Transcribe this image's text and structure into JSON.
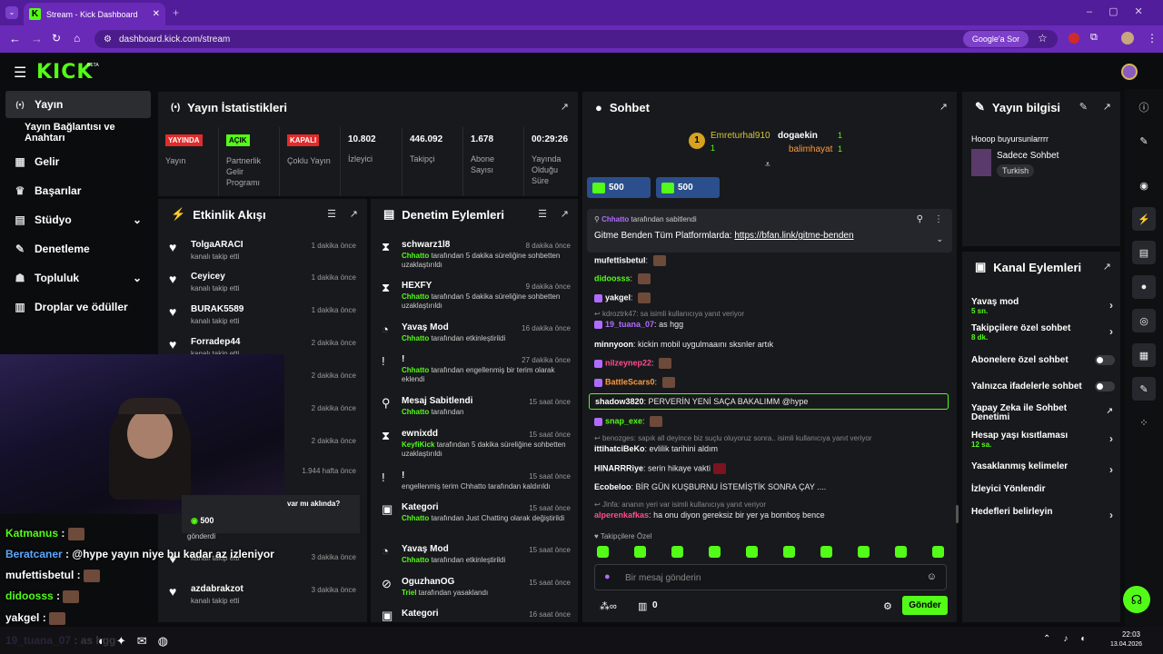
{
  "browser": {
    "tab_title": "Stream - Kick Dashboard",
    "url": "dashboard.kick.com/stream",
    "google_btn": "Google'a Sor"
  },
  "brand": {
    "logo": "KICK",
    "beta": "BETA",
    "accent": "#53fc18"
  },
  "sidebar": [
    {
      "label": "Yayın",
      "icon": "broadcast-icon",
      "active": true
    },
    {
      "label": "Yayın Bağlantısı ve Anahtarı",
      "icon": ""
    },
    {
      "label": "Gelir",
      "icon": "revenue-icon"
    },
    {
      "label": "Başarılar",
      "icon": "trophy-icon"
    },
    {
      "label": "Stüdyo",
      "icon": "studio-icon",
      "chev": "⌄"
    },
    {
      "label": "Denetleme",
      "icon": "wrench-icon"
    },
    {
      "label": "Topluluk",
      "icon": "community-icon",
      "chev": "⌄"
    },
    {
      "label": "Droplar ve ödüller",
      "icon": "gift-icon"
    }
  ],
  "stats": {
    "title": "Yayın İstatistikleri",
    "items": [
      {
        "badge": "YAYINDA",
        "label": "Yayın"
      },
      {
        "badge": "AÇIK",
        "label": "Partnerlik Gelir Programı"
      },
      {
        "badge": "KAPALI",
        "label": "Çoklu Yayın"
      },
      {
        "value": "10.802",
        "label": "İzleyici"
      },
      {
        "value": "446.092",
        "label": "Takipçi"
      },
      {
        "value": "1.678",
        "label": "Abone Sayısı"
      },
      {
        "value": "00:29:26",
        "label": "Yayında Olduğu Süre"
      }
    ]
  },
  "activity": {
    "title": "Etkinlik Akışı",
    "items": [
      {
        "name": "TolgaARACI",
        "sub": "kanalı takip etti",
        "time": "1 dakika önce"
      },
      {
        "name": "Ceyicey",
        "sub": "kanalı takip etti",
        "time": "1 dakika önce"
      },
      {
        "name": "BURAK5589",
        "sub": "kanalı takip etti",
        "time": "1 dakika önce"
      },
      {
        "name": "Forradep44",
        "sub": "kanalı takip etti",
        "time": "2 dakika önce"
      },
      {
        "name": "",
        "sub": "",
        "time": "2 dakika önce"
      },
      {
        "name": "",
        "sub": "",
        "time": "2 dakika önce"
      },
      {
        "name": "",
        "sub": "",
        "time": "2 dakika önce"
      },
      {
        "name": "",
        "sub": "",
        "time": "1.944 hafta önce"
      }
    ],
    "card_text": "var mı aklında?",
    "card_amount": "500",
    "card_sub": "gönderdi",
    "more": [
      {
        "name": "",
        "sub": "kanalı takip etti",
        "time": "3 dakika önce"
      },
      {
        "name": "azdabrakzot",
        "sub": "kanalı takip etti",
        "time": "3 dakika önce"
      }
    ]
  },
  "moderation": {
    "title": "Denetim Eylemleri",
    "items": [
      {
        "icon": "⧗",
        "name": "schwarz1l8",
        "pre": "Chhatto",
        "sub": " tarafından 5 dakika süreliğine sohbetten uzaklaştırıldı",
        "time": "8 dakika önce"
      },
      {
        "icon": "⧗",
        "name": "HEXFY",
        "pre": "Chhatto",
        "sub": " tarafından 5 dakika süreliğine sohbetten uzaklaştırıldı",
        "time": "9 dakika önce"
      },
      {
        "icon": "◔",
        "name": "Yavaş Mod",
        "pre": "Chhatto",
        "sub": " tarafından etkinleştirildi",
        "time": "16 dakika önce"
      },
      {
        "icon": "!",
        "name": "!",
        "pre": "Chhatto",
        "sub": " tarafından engellenmiş bir terim olarak eklendi",
        "time": "27 dakika önce"
      },
      {
        "icon": "⚲",
        "name": "Mesaj Sabitlendi",
        "pre": "Chhatto",
        "sub": " tarafından",
        "time": "15 saat önce"
      },
      {
        "icon": "⧗",
        "name": "ewnixdd",
        "pre": "KeyfiKick",
        "sub": " tarafından 5 dakika süreliğine sohbetten uzaklaştırıldı",
        "time": "15 saat önce"
      },
      {
        "icon": "!",
        "name": "!",
        "pre": "",
        "sub": "engellenmiş terim Chhatto tarafından kaldırıldı",
        "time": "15 saat önce"
      },
      {
        "icon": "▣",
        "name": "Kategori",
        "pre": "Chhatto",
        "sub": " tarafından Just Chatting olarak değiştirildi",
        "time": "15 saat önce"
      },
      {
        "icon": "◔",
        "name": "Yavaş Mod",
        "pre": "Chhatto",
        "sub": " tarafından etkinleştirildi",
        "time": "15 saat önce"
      },
      {
        "icon": "⊘",
        "name": "OguzhanOG",
        "pre": "Triel",
        "sub": " tarafından yasaklandı",
        "time": "15 saat önce"
      },
      {
        "icon": "▣",
        "name": "Kategori",
        "pre": "",
        "sub": "",
        "time": "16 saat önce"
      }
    ]
  },
  "chat": {
    "title": "Sohbet",
    "top": [
      {
        "rank": "1",
        "name": "Emreturhal910",
        "count": "1"
      },
      {
        "name": "dogaekin",
        "count": "1"
      },
      {
        "name": "balimhayat",
        "count": "1"
      }
    ],
    "gifts": [
      {
        "amount": "500"
      },
      {
        "amount": "500"
      }
    ],
    "pinned": {
      "by": "Chhatto",
      "by_suffix": "tarafından sabitlendi",
      "text": "Gitme Benden Tüm Platformlarda: ",
      "link": "https://bfan.link/gitme-benden"
    },
    "messages": [
      {
        "user": "mufettisbetul",
        "color": "#ffffff",
        "text": "",
        "emote": true
      },
      {
        "user": "didoosss",
        "color": "#53fc18",
        "text": "",
        "emote": true
      },
      {
        "user": "yakgel",
        "color": "#ffffff",
        "text": "",
        "emote": true
      },
      {
        "reply": "kdroztrk47: sa isimli kullanıcıya yanıt veriyor",
        "user": "19_tuana_07",
        "color": "#b06cff",
        "text": "as hgg"
      },
      {
        "user": "minnyoon",
        "color": "#ffffff",
        "text": "kickin mobil uygulmaaını sksnler artık"
      },
      {
        "user": "nilzeynep22",
        "color": "#ff4d8d",
        "text": "",
        "emote": true
      },
      {
        "user": "BattleScars0",
        "color": "#ff9a3c",
        "text": "",
        "emote": true
      },
      {
        "user": "shadow3820",
        "color": "#ffffff",
        "text": "PERVERİN YENİ SAÇA BAKALIMM @hype",
        "highlight": true
      },
      {
        "user": "snap_exe",
        "color": "#53fc18",
        "text": "",
        "emote": true
      },
      {
        "reply": "benozges: sapık all deyince biz suçlu oluyoruz sonra.. isimli kullanıcıya yanıt veriyor",
        "user": "ittihatciBeKo",
        "color": "#ffffff",
        "text": "evlilik tarihini aldım"
      },
      {
        "user": "HINARRRiye",
        "color": "#ffffff",
        "text": "serin hikaye vakti"
      },
      {
        "user": "Ecobeloo",
        "color": "#ffffff",
        "text": "BİR GÜN KUŞBURNU İSTEMİŞTİK SONRA ÇAY ...."
      },
      {
        "reply": "Jinfa: ananın yeri var isimli kullanıcıya yanıt veriyor",
        "user": "alperenkafkas",
        "color": "#ff4d8d",
        "text": "ha onu diyon gereksiz bir yer ya bomboş bence"
      }
    ],
    "followers_only": "Takipçilere Özel",
    "input_placeholder": "Bir mesaj gönderin",
    "points": "0",
    "send": "Gönder"
  },
  "info": {
    "title": "Yayın bilgisi",
    "stream_title": "Hooop buyursunlarrrr",
    "category": "Sadece Sohbet",
    "tag": "Turkish"
  },
  "actions": {
    "title": "Kanal Eylemleri",
    "items": [
      {
        "label": "Yavaş mod",
        "sub": "5 sn.",
        "ctl": "chev"
      },
      {
        "label": "Takipçilere özel sohbet",
        "sub": "8 dk.",
        "ctl": "chev"
      },
      {
        "label": "Abonelere özel sohbet",
        "sub": "",
        "ctl": "toggle"
      },
      {
        "label": "Yalnızca ifadelerle sohbet",
        "sub": "",
        "ctl": "toggle"
      },
      {
        "label": "Yapay Zeka ile Sohbet Denetimi",
        "sub": "",
        "ctl": "ext"
      },
      {
        "label": "Hesap yaşı kısıtlaması",
        "sub": "12 sa.",
        "ctl": "chev"
      },
      {
        "label": "Yasaklanmış kelimeler",
        "sub": "",
        "ctl": "chev"
      },
      {
        "label": "İzleyici Yönlendir",
        "sub": "",
        "ctl": ""
      },
      {
        "label": "Hedefleri belirleyin",
        "sub": "",
        "ctl": "chev"
      }
    ]
  },
  "overlay": [
    {
      "user": "Katmanus",
      "color": "#53fc18",
      "text": ""
    },
    {
      "user": "Beratcaner",
      "color": "#5aa8ff",
      "text": "@hype yayın niye bu kadar az izleniyor"
    },
    {
      "user": "mufettisbetul",
      "color": "#ffffff",
      "text": ""
    },
    {
      "user": "didoosss",
      "color": "#53fc18",
      "text": ""
    },
    {
      "user": "yakgel",
      "color": "#ffffff",
      "text": ""
    },
    {
      "user": "19_tuana_07",
      "color": "#b06cff",
      "text": "as hgg"
    }
  ],
  "taskbar": {
    "time": "22:03",
    "date": "13.04.2026"
  }
}
